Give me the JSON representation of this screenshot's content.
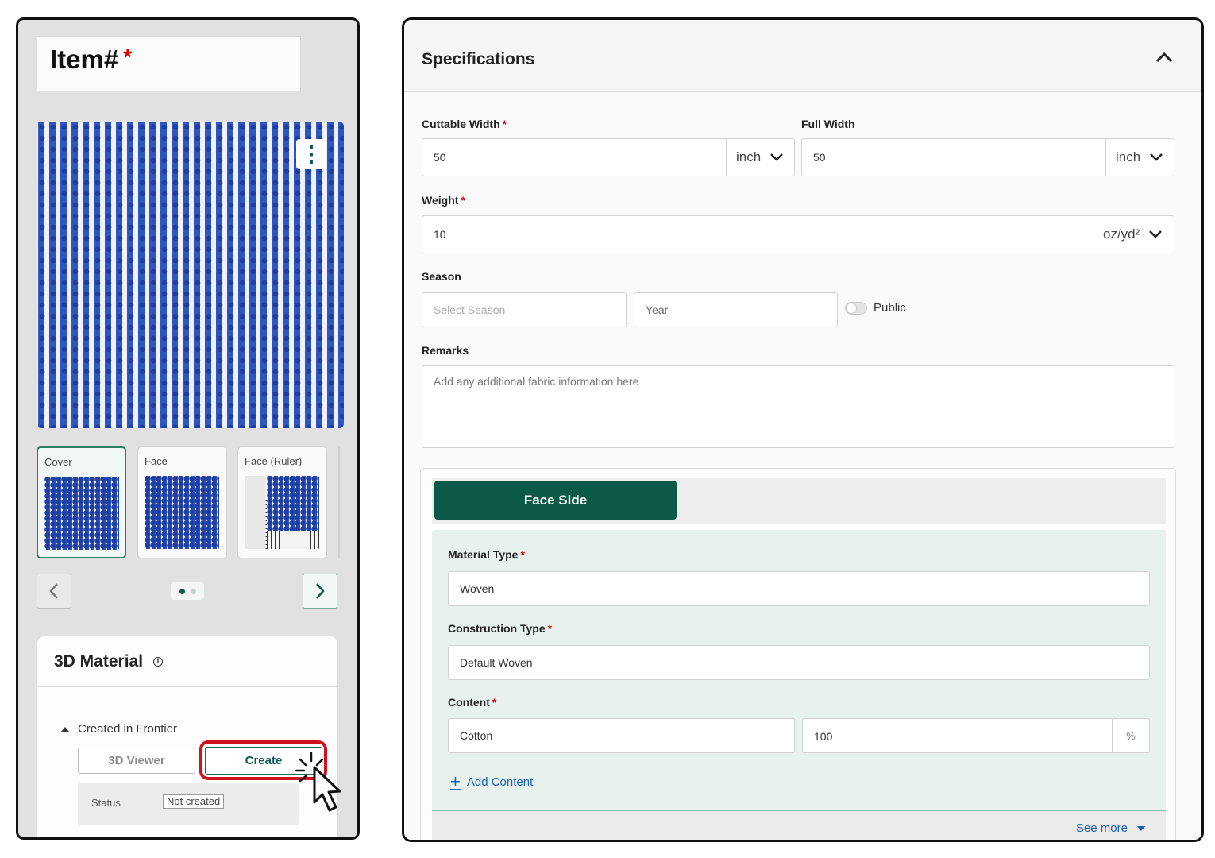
{
  "left_panel": {
    "item_label": "Item#",
    "required_mark": "*",
    "more_icon": "⋮",
    "thumbnails": [
      {
        "label": "Cover",
        "active": true
      },
      {
        "label": "Face",
        "active": false
      },
      {
        "label": "Face (Ruler)",
        "active": false
      }
    ],
    "pager": {
      "pages": 2,
      "current": 1
    },
    "material": {
      "title": "3D Material",
      "info_icon": "i",
      "section_label": "Created in Frontier",
      "viewer_button": "3D Viewer",
      "create_button": "Create",
      "status_label": "Status",
      "status_value": "Not created"
    }
  },
  "specifications": {
    "title": "Specifications",
    "cuttable_width": {
      "label": "Cuttable Width",
      "value": "50",
      "unit": "inch"
    },
    "full_width": {
      "label": "Full Width",
      "value": "50",
      "unit": "inch"
    },
    "weight": {
      "label": "Weight",
      "value": "10",
      "unit": "oz/yd²"
    },
    "season": {
      "label": "Season",
      "season_placeholder": "Select Season",
      "year_placeholder": "Year",
      "public_label": "Public",
      "public_on": false
    },
    "remarks": {
      "label": "Remarks",
      "placeholder": "Add any additional fabric information here"
    },
    "face_side": {
      "tab_label": "Face Side",
      "material_type": {
        "label": "Material Type",
        "value": "Woven"
      },
      "construction_type": {
        "label": "Construction Type",
        "value": "Default Woven"
      },
      "content": {
        "label": "Content",
        "fiber": "Cotton",
        "percent": "100",
        "percent_unit": "%"
      },
      "add_content": "Add Content",
      "see_more": "See more"
    }
  },
  "colors": {
    "brand_green": "#0b5a48",
    "highlight_red": "#d0141c",
    "link_blue": "#1a5fb8"
  }
}
